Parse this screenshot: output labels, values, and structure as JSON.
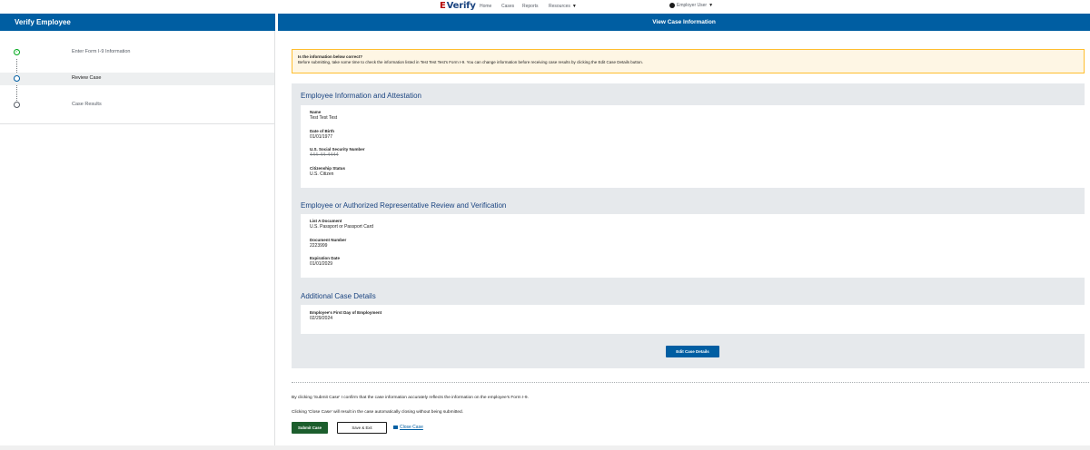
{
  "topnav": {
    "logo_prefix": "E",
    "logo_text": "Verify",
    "links": [
      "Home",
      "Cases",
      "Reports",
      "Resources"
    ],
    "user_label": "Employer User"
  },
  "sidebar": {
    "title": "Verify Employee",
    "steps": [
      {
        "label": "Enter Form I-9 Information",
        "state": "done"
      },
      {
        "label": "Review Case",
        "state": "current"
      },
      {
        "label": "Case Results",
        "state": "pending"
      }
    ]
  },
  "main": {
    "title": "View Case Information",
    "alert": {
      "title": "Is the information below correct?",
      "body": "Before submitting, take some time to check the information listed in Test Test Test's Form I-9. You can change information before receiving case results by clicking the Edit Case Details button."
    },
    "sections": {
      "employee": {
        "title": "Employee Information and Attestation",
        "fields": [
          {
            "label": "Name",
            "value": "Test Test Test"
          },
          {
            "label": "Date of Birth",
            "value": "01/01/1977"
          },
          {
            "label": "U.S. Social Security Number",
            "value": "444-44-4444"
          },
          {
            "label": "Citizenship Status",
            "value": "U.S. Citizen"
          }
        ]
      },
      "review": {
        "title": "Employee or Authorized Representative Review and Verification",
        "fields": [
          {
            "label": "List A Document",
            "value": "U.S. Passport or Passport Card"
          },
          {
            "label": "Document Number",
            "value": "2223999"
          },
          {
            "label": "Expiration Date",
            "value": "01/01/2029"
          }
        ]
      },
      "additional": {
        "title": "Additional Case Details",
        "fields": [
          {
            "label": "Employee's First Day of Employment",
            "value": "02/29/2024"
          }
        ]
      }
    },
    "edit_button": "Edit Case Details",
    "confirm_text": "By clicking 'Submit Case' I confirm that the case information accurately reflects the information on the employee's Form I-9.",
    "close_note": "Clicking 'Close Case' will result in the case automatically closing without being submitted.",
    "submit_button": "Submit Case",
    "save_button": "Save & Exit",
    "close_link": "Close Case"
  }
}
